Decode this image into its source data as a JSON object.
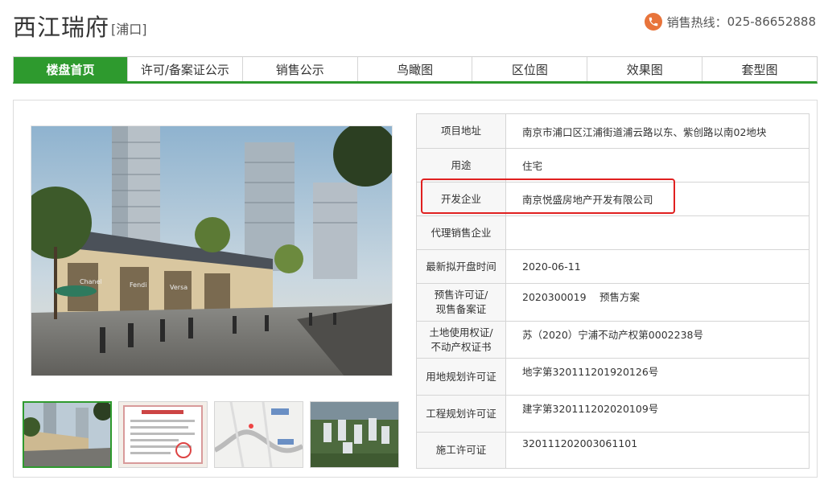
{
  "header": {
    "title": "西江瑞府",
    "district": "[浦口]",
    "hotline_label": "销售热线：",
    "hotline_number": "025-86652888"
  },
  "nav": {
    "tabs": [
      {
        "label": "楼盘首页",
        "active": true
      },
      {
        "label": "许可/备案证公示"
      },
      {
        "label": "销售公示"
      },
      {
        "label": "鸟瞰图"
      },
      {
        "label": "区位图"
      },
      {
        "label": "效果图"
      },
      {
        "label": "套型图"
      }
    ]
  },
  "info": {
    "rows": [
      {
        "key": "项目地址",
        "value": "南京市浦口区江浦街道浦云路以东、紫创路以南02地块"
      },
      {
        "key": "用途",
        "value": "住宅"
      },
      {
        "key": "开发企业",
        "value": "南京悦盛房地产开发有限公司"
      },
      {
        "key": "代理销售企业",
        "value": ""
      },
      {
        "key": "最新拟开盘时间",
        "value": "2020-06-11"
      },
      {
        "key_line1": "预售许可证/",
        "key_line2": "现售备案证",
        "value": "2020300019　 预售方案"
      },
      {
        "key_line1": "土地使用权证/",
        "key_line2": "不动产权证书",
        "value": "苏（2020）宁浦不动产权第0002238号"
      },
      {
        "key": "用地规划许可证",
        "value": "地字第320111201920126号"
      },
      {
        "key": "工程规划许可证",
        "value": "建字第320111202020109号"
      },
      {
        "key": "施工许可证",
        "value": "320111202003061101"
      }
    ]
  },
  "gallery": {
    "storefront_signs": [
      "Chanel",
      "Fendi",
      "Versa"
    ]
  },
  "colors": {
    "accent_green": "#2e9a2e",
    "highlight_red": "#e02020",
    "phone_orange": "#e8743b"
  }
}
